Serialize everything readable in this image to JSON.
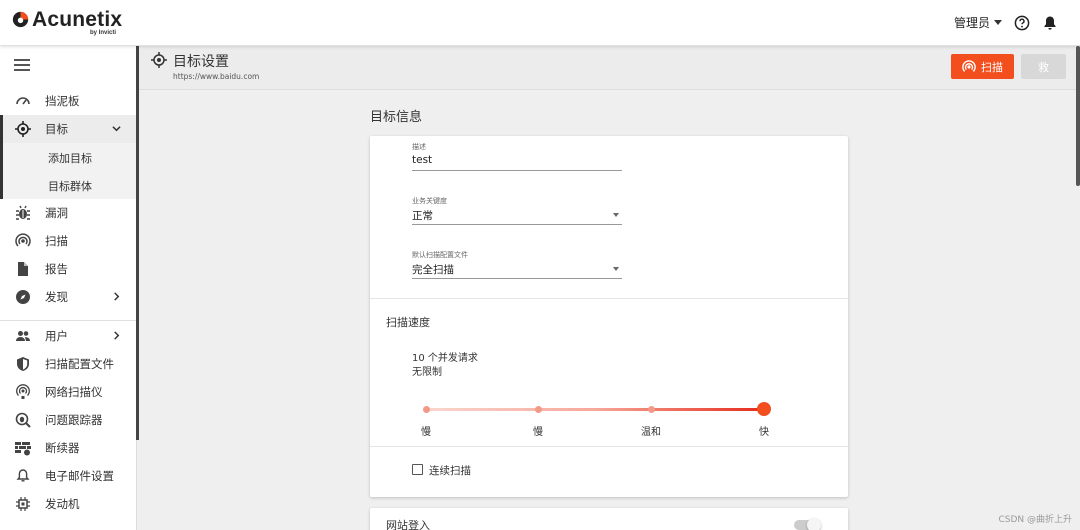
{
  "brand": {
    "name": "Acunetix",
    "sub": "by Invicti",
    "color": "#f24e1e"
  },
  "topbar": {
    "user_label": "管理员"
  },
  "sidebar": {
    "items": [
      {
        "label": "挡泥板",
        "icon": "speedometer-icon"
      },
      {
        "label": "目标",
        "icon": "target-icon",
        "active": true,
        "expanded": true
      },
      {
        "label": "漏洞",
        "icon": "bug-icon"
      },
      {
        "label": "扫描",
        "icon": "radar-icon"
      },
      {
        "label": "报告",
        "icon": "document-icon"
      },
      {
        "label": "发现",
        "icon": "compass-icon"
      },
      {
        "label": "用户",
        "icon": "users-icon"
      },
      {
        "label": "扫描配置文件",
        "icon": "shield-icon"
      },
      {
        "label": "网络扫描仪",
        "icon": "network-scanner-icon"
      },
      {
        "label": "问题跟踪器",
        "icon": "bug-search-icon"
      },
      {
        "label": "断续器",
        "icon": "firewall-icon"
      },
      {
        "label": "电子邮件设置",
        "icon": "bell-icon"
      },
      {
        "label": "发动机",
        "icon": "chip-icon"
      }
    ],
    "subitems": [
      "添加目标",
      "目标群体"
    ]
  },
  "header": {
    "title": "目标设置",
    "url": "https://www.baidu.com",
    "scan_label": "扫描",
    "save_label": "救"
  },
  "main": {
    "section_title": "目标信息",
    "fields": {
      "description": {
        "label": "描述",
        "value": "test"
      },
      "criticality": {
        "label": "业务关键度",
        "value": "正常"
      },
      "profile": {
        "label": "默认扫描配置文件",
        "value": "完全扫描"
      }
    },
    "speed": {
      "title": "扫描速度",
      "desc1": "10 个并发请求",
      "desc2": "无限制",
      "labels": [
        "慢",
        "慢",
        "温和",
        "快"
      ],
      "selected_index": 3
    },
    "continuous_scan": {
      "label": "连续扫描",
      "checked": false
    },
    "site_login": {
      "title": "网站登入",
      "enabled": false
    }
  },
  "watermark": "CSDN @曲折上升"
}
